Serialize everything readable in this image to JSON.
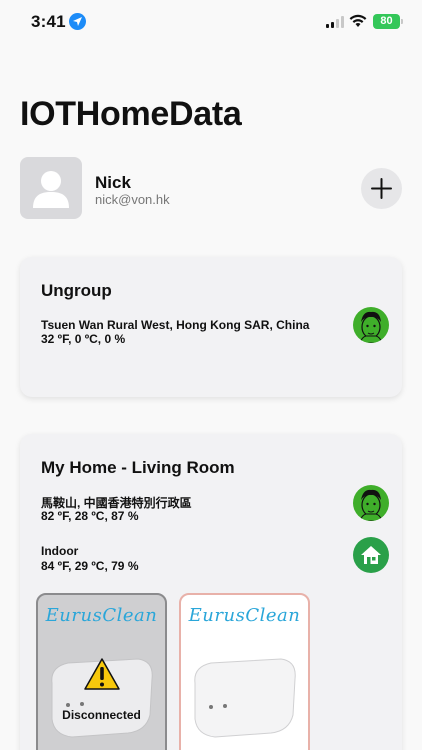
{
  "status_bar": {
    "time": "3:41",
    "battery": "80"
  },
  "app": {
    "title": "IOTHomeData"
  },
  "profile": {
    "name": "Nick",
    "email": "nick@von.hk"
  },
  "groups": [
    {
      "title": "Ungroup",
      "locations": [
        {
          "name": "Tsuen Wan Rural West, Hong Kong SAR, China",
          "readings": "32 ºF, 0 ºC, 0 %",
          "icon": "avatar-face-icon"
        }
      ]
    },
    {
      "title": "My Home - Living Room",
      "locations": [
        {
          "name": "馬鞍山, 中國香港特別行政區",
          "readings": "82 ºF, 28 ºC, 87 %",
          "icon": "avatar-face-icon"
        },
        {
          "name": "Indoor",
          "readings": "84 ºF, 29 ºC, 79 %",
          "icon": "home-icon"
        }
      ],
      "devices": [
        {
          "brand": "EurusClean",
          "status": "Disconnected"
        },
        {
          "brand": "EurusClean",
          "status": ""
        }
      ]
    }
  ],
  "colors": {
    "accent_green": "#3fae2a",
    "brand_blue": "#2aa6d9",
    "battery_green": "#34c759",
    "location_blue": "#1d8cf8"
  }
}
